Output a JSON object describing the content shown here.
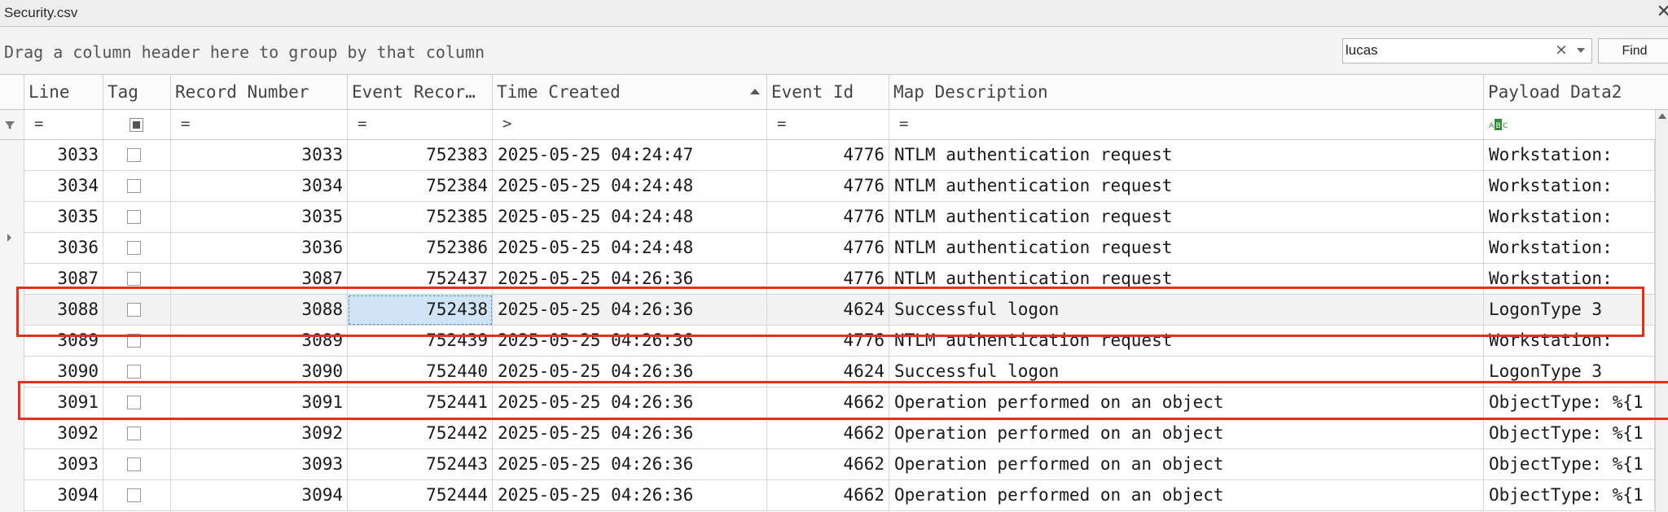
{
  "window": {
    "title": "Security.csv"
  },
  "groupbar": {
    "hint": "Drag a column header here to group by that column"
  },
  "search": {
    "value": "lucas",
    "clear": "×",
    "find_label": "Find"
  },
  "columns": {
    "line": "Line",
    "tag": "Tag",
    "record_number": "Record Number",
    "event_record": "Event Recor…",
    "time_created": "Time Created",
    "event_id": "Event Id",
    "map_description": "Map Description",
    "payload_data2": "Payload Data2"
  },
  "filters": {
    "line": "=",
    "record_number": "=",
    "event_record": "=",
    "time_created": ">",
    "event_id": "=",
    "map_description": "="
  },
  "rows": [
    {
      "line": "3033",
      "record": "3033",
      "event_record": "752383",
      "time": "2025-05-25 04:24:47",
      "event_id": "4776",
      "desc": "NTLM authentication request",
      "payload": "Workstation:"
    },
    {
      "line": "3034",
      "record": "3034",
      "event_record": "752384",
      "time": "2025-05-25 04:24:48",
      "event_id": "4776",
      "desc": "NTLM authentication request",
      "payload": "Workstation:"
    },
    {
      "line": "3035",
      "record": "3035",
      "event_record": "752385",
      "time": "2025-05-25 04:24:48",
      "event_id": "4776",
      "desc": "NTLM authentication request",
      "payload": "Workstation:"
    },
    {
      "line": "3036",
      "record": "3036",
      "event_record": "752386",
      "time": "2025-05-25 04:24:48",
      "event_id": "4776",
      "desc": "NTLM authentication request",
      "payload": "Workstation:"
    },
    {
      "line": "3087",
      "record": "3087",
      "event_record": "752437",
      "time": "2025-05-25 04:26:36",
      "event_id": "4776",
      "desc": "NTLM authentication request",
      "payload": "Workstation:"
    },
    {
      "line": "3088",
      "record": "3088",
      "event_record": "752438",
      "time": "2025-05-25 04:26:36",
      "event_id": "4624",
      "desc": "Successful logon",
      "payload": "LogonType 3"
    },
    {
      "line": "3089",
      "record": "3089",
      "event_record": "752439",
      "time": "2025-05-25 04:26:36",
      "event_id": "4776",
      "desc": "NTLM authentication request",
      "payload": "Workstation:"
    },
    {
      "line": "3090",
      "record": "3090",
      "event_record": "752440",
      "time": "2025-05-25 04:26:36",
      "event_id": "4624",
      "desc": "Successful logon",
      "payload": "LogonType 3"
    },
    {
      "line": "3091",
      "record": "3091",
      "event_record": "752441",
      "time": "2025-05-25 04:26:36",
      "event_id": "4662",
      "desc": "Operation performed on an object",
      "payload": "ObjectType: %{1"
    },
    {
      "line": "3092",
      "record": "3092",
      "event_record": "752442",
      "time": "2025-05-25 04:26:36",
      "event_id": "4662",
      "desc": "Operation performed on an object",
      "payload": "ObjectType: %{1"
    },
    {
      "line": "3093",
      "record": "3093",
      "event_record": "752443",
      "time": "2025-05-25 04:26:36",
      "event_id": "4662",
      "desc": "Operation performed on an object",
      "payload": "ObjectType: %{1"
    },
    {
      "line": "3094",
      "record": "3094",
      "event_record": "752444",
      "time": "2025-05-25 04:26:36",
      "event_id": "4662",
      "desc": "Operation performed on an object",
      "payload": "ObjectType: %{1"
    }
  ],
  "colors": {
    "highlight_box": "#e0321c",
    "selected_cell": "#cfe4f7"
  }
}
